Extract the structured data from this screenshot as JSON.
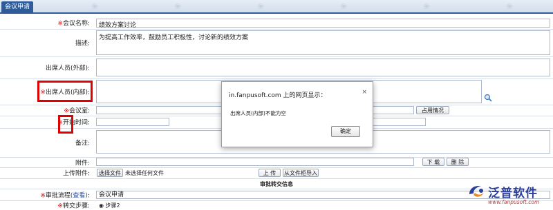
{
  "header": {
    "tab_label": "会议申请"
  },
  "form": {
    "meeting_name": {
      "label": "会议名称:",
      "value": "绩效方案讨论"
    },
    "description": {
      "label": "描述:",
      "value": "为提高工作效率，鼓励员工积极性，讨论新的绩效方案"
    },
    "attendees_external": {
      "label": "出席人员(外部):"
    },
    "attendees_internal": {
      "label": "出席人员(内部):"
    },
    "meeting_room": {
      "label": "会议室:",
      "button": "占用情况"
    },
    "start_time": {
      "label": "开始时间:"
    },
    "remarks": {
      "label": "备注:"
    },
    "attachment": {
      "label": "附件:",
      "download": "下 载",
      "delete": "删 除"
    },
    "upload": {
      "label": "上传附件:",
      "choose": "选择文件",
      "no_file": "未选择任何文件",
      "upload": "上 传",
      "import": "从文件柜导入"
    },
    "approval_section": "审批转交信息",
    "workflow": {
      "label": "审批流程",
      "link": "(查看)",
      "colon": ":",
      "value": "会议申请"
    },
    "step": {
      "label": "转交步骤:",
      "value": "步骤2"
    },
    "required_mark": "※"
  },
  "dialog": {
    "title": "in.fanpusoft.com 上的网页显示：",
    "message": "出席人员(内部)不能为空",
    "ok": "确定",
    "close": "×"
  },
  "watermark": {
    "brand": "泛普软件",
    "url": "www.fanpusoft.com"
  }
}
